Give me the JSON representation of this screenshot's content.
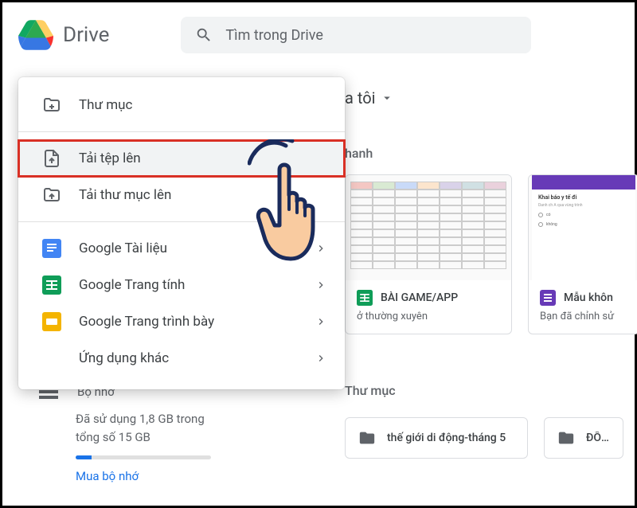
{
  "header": {
    "app_name": "Drive",
    "search_placeholder": "Tìm trong Drive"
  },
  "breadcrumb": {
    "label": "a tôi"
  },
  "quick_access": {
    "title": "hanh"
  },
  "files": [
    {
      "title": "BÀI GAME/APP",
      "subtitle": "ở thường xuyên",
      "icon": "sheets"
    },
    {
      "title": "Mẫu khôn",
      "subtitle": "Bạn đã chỉnh sử",
      "icon": "forms",
      "preview": {
        "heading": "Khai báo y tế đi",
        "sub": "Danh ch A qua vùng trình",
        "options": [
          "có",
          "không"
        ]
      }
    }
  ],
  "folders_section": {
    "title": "Thư mục",
    "folders": [
      {
        "name": "thế giới di động-tháng 5"
      },
      {
        "name": "ĐỒ ÁN"
      }
    ]
  },
  "storage": {
    "title": "Bộ nhớ",
    "usage_text": "Đã sử dụng 1,8 GB trong tổng số 15 GB",
    "buy_text": "Mua bộ nhớ"
  },
  "context_menu": {
    "items": [
      {
        "label": "Thư mục",
        "icon": "folder-new",
        "submenu": false
      },
      {
        "divider": true
      },
      {
        "label": "Tải tệp lên",
        "icon": "file-upload",
        "submenu": false,
        "highlight": true
      },
      {
        "label": "Tải thư mục lên",
        "icon": "folder-upload",
        "submenu": false
      },
      {
        "divider": true
      },
      {
        "label": "Google Tài liệu",
        "icon": "docs",
        "submenu": true
      },
      {
        "label": "Google Trang tính",
        "icon": "sheets",
        "submenu": true
      },
      {
        "label": "Google Trang trình bày",
        "icon": "slides",
        "submenu": true
      },
      {
        "label": "Ứng dụng khác",
        "icon": "",
        "submenu": true
      }
    ]
  }
}
